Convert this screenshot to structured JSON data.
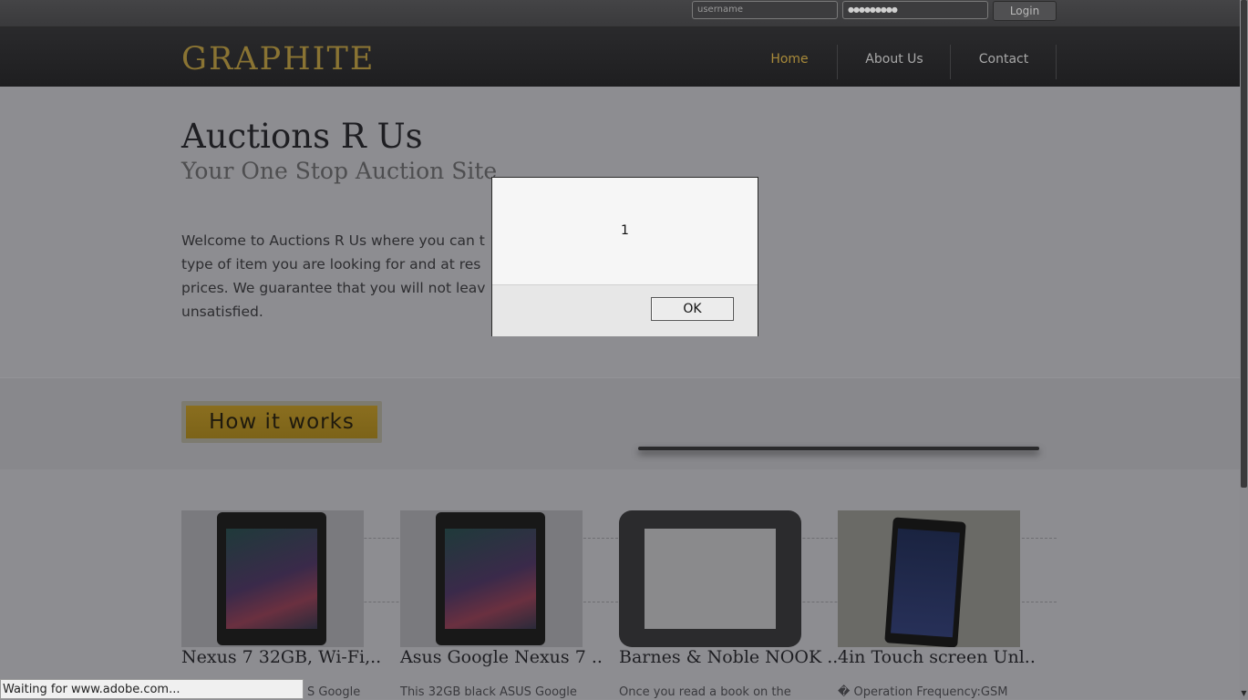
{
  "topbar": {
    "username_placeholder": "username",
    "password_value": "●●●●●●●●●",
    "login_label": "Login"
  },
  "header": {
    "logo": "GRAPHITE",
    "nav": [
      {
        "label": "Home"
      },
      {
        "label": "About Us"
      },
      {
        "label": "Contact"
      }
    ]
  },
  "hero": {
    "title": "Auctions R Us",
    "subtitle": "Your One Stop Auction Site",
    "welcome": "Welcome to Auctions R Us where you can t\ntype of item you are looking for and at res\nprices. We guarantee that you will not leav\nunsatisfied."
  },
  "band": {
    "how_it_works": "How it works"
  },
  "products": [
    {
      "title": "Nexus 7 32GB, Wi-Fi,..",
      "desc": "S Google"
    },
    {
      "title": "Asus Google Nexus 7 ..",
      "desc": "This 32GB black ASUS Google"
    },
    {
      "title": "Barnes & Noble NOOK ..",
      "desc": "Once you read a book on the"
    },
    {
      "title": "4in Touch screen Unl..",
      "desc": "� Operation Frequency:GSM"
    }
  ],
  "status_bar": "Waiting for www.adobe.com...",
  "dialog": {
    "message": "1",
    "ok_label": "OK"
  }
}
